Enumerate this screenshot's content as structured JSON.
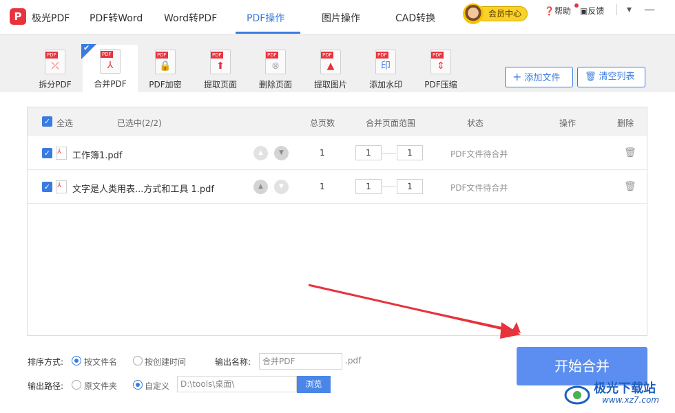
{
  "app": {
    "logo_letter": "P",
    "name": "极光PDF"
  },
  "nav": {
    "tabs": [
      "PDF转Word",
      "Word转PDF",
      "PDF操作",
      "图片操作",
      "CAD转换"
    ],
    "active": "PDF操作"
  },
  "member": {
    "label": "会员中心"
  },
  "top_actions": {
    "help": "帮助",
    "feedback": "反馈"
  },
  "toolbar": {
    "tools": [
      {
        "label": "拆分PDF",
        "icon": "split-pdf-icon"
      },
      {
        "label": "合并PDF",
        "icon": "merge-pdf-icon"
      },
      {
        "label": "PDF加密",
        "icon": "encrypt-pdf-icon"
      },
      {
        "label": "提取页面",
        "icon": "extract-page-icon"
      },
      {
        "label": "删除页面",
        "icon": "delete-page-icon"
      },
      {
        "label": "提取图片",
        "icon": "extract-image-icon"
      },
      {
        "label": "添加水印",
        "icon": "watermark-icon"
      },
      {
        "label": "PDF压缩",
        "icon": "compress-pdf-icon"
      }
    ],
    "active": "合并PDF",
    "pdf_tag": "PDF",
    "add_file": "添加文件",
    "clear_list": "清空列表"
  },
  "table": {
    "select_all": "全选",
    "selected_count": "已选中(2/2)",
    "headers": {
      "total_pages": "总页数",
      "range": "合并页面范围",
      "status": "状态",
      "action": "操作",
      "delete": "删除"
    },
    "rows": [
      {
        "name": "工作簿1.pdf",
        "pages": "1",
        "from": "1",
        "to": "1",
        "status": "PDF文件待合并"
      },
      {
        "name": "文字是人类用表...方式和工具 1.pdf",
        "pages": "1",
        "from": "1",
        "to": "1",
        "status": "PDF文件待合并"
      }
    ]
  },
  "options": {
    "sort_label": "排序方式:",
    "sort_by_name": "按文件名",
    "sort_by_time": "按创建时间",
    "output_name_label": "输出名称:",
    "output_name_placeholder": "合并PDF",
    "ext": ".pdf",
    "output_path_label": "输出路径:",
    "path_original": "原文件夹",
    "path_custom": "自定义",
    "path_value": "D:\\tools\\桌面\\",
    "browse": "浏览"
  },
  "start_button": "开始合并",
  "watermark": {
    "text": "极光下载站",
    "url": "www.xz7.com"
  },
  "colors": {
    "accent": "#3a7be0",
    "brand_red": "#e8323c",
    "start_button": "#5b8ef0",
    "arrow": "#e8323c"
  }
}
